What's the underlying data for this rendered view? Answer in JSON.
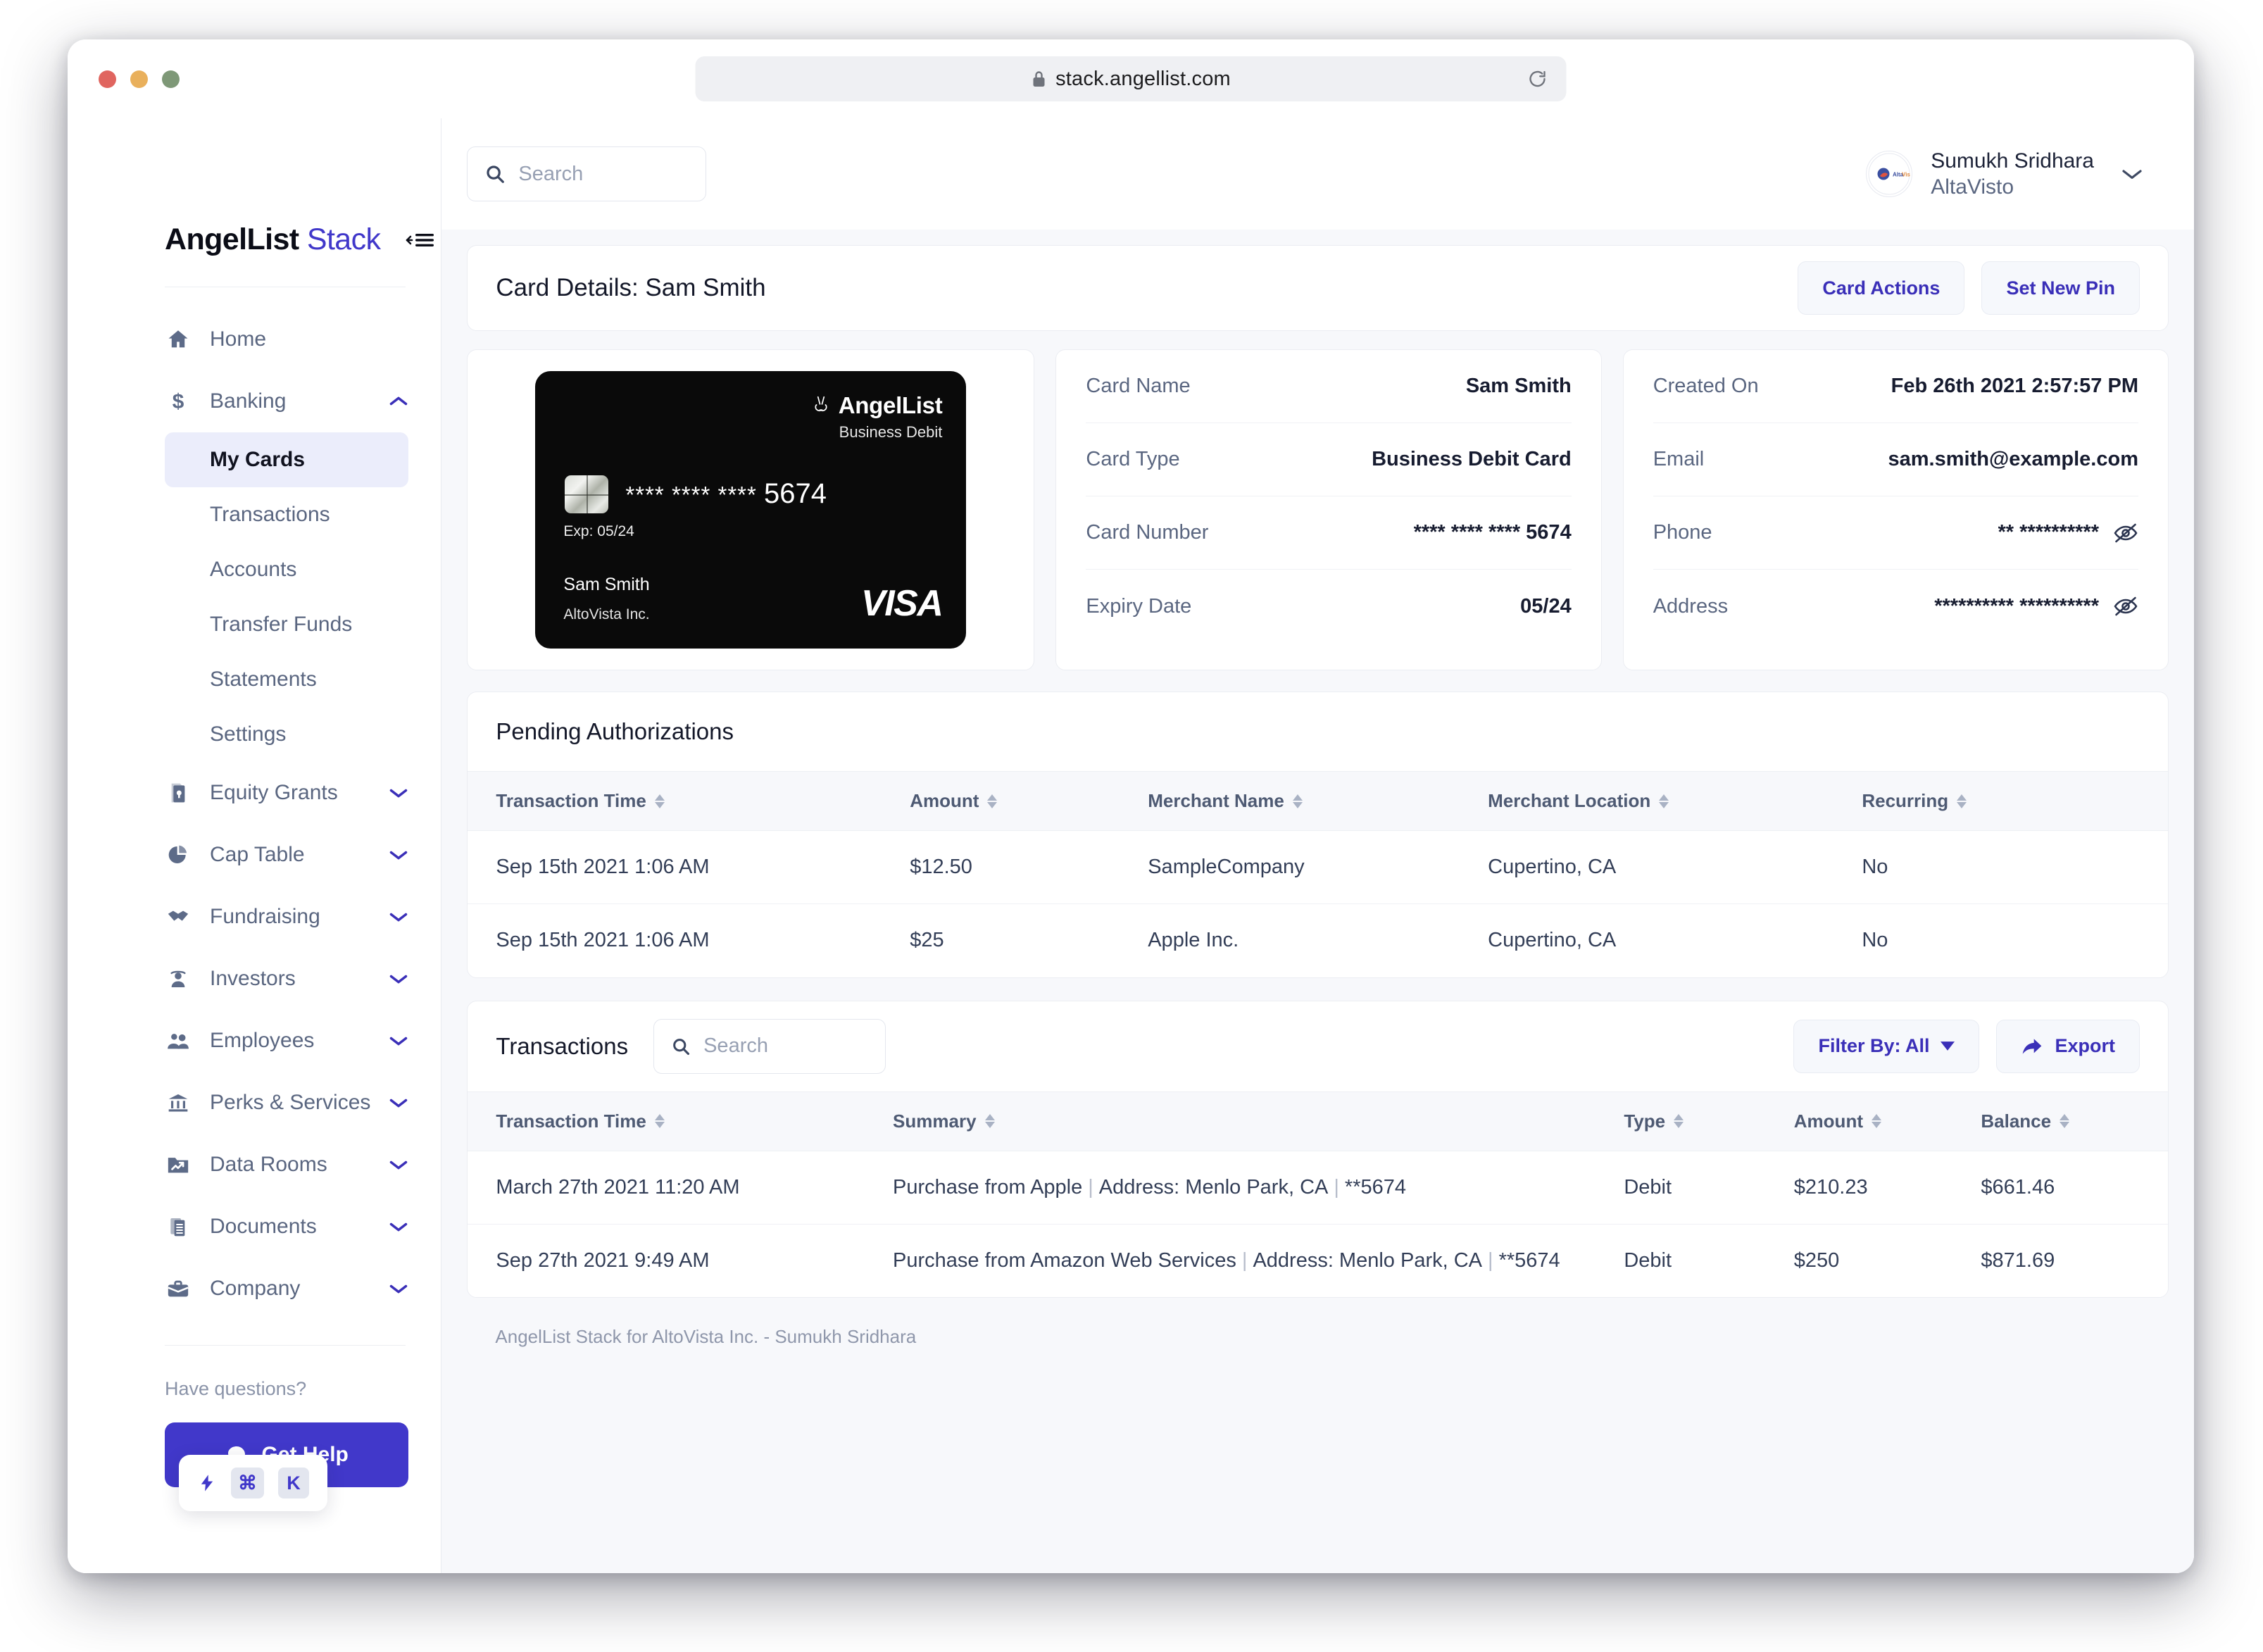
{
  "browser": {
    "url": "stack.angellist.com",
    "lock_icon": "lock-icon",
    "reload_icon": "reload-icon"
  },
  "sidebar": {
    "brand_primary": "AngelList",
    "brand_secondary": "Stack",
    "collapse_icon": "collapse-menu-icon",
    "nav": [
      {
        "label": "Home",
        "icon": "home-icon",
        "expandable": false
      },
      {
        "label": "Banking",
        "icon": "dollar-icon",
        "expandable": true,
        "expanded": true
      },
      {
        "label": "Equity Grants",
        "icon": "certificate-icon",
        "expandable": true
      },
      {
        "label": "Cap Table",
        "icon": "pie-chart-icon",
        "expandable": true
      },
      {
        "label": "Fundraising",
        "icon": "handshake-icon",
        "expandable": true
      },
      {
        "label": "Investors",
        "icon": "investor-icon",
        "expandable": true
      },
      {
        "label": "Employees",
        "icon": "people-icon",
        "expandable": true
      },
      {
        "label": "Perks & Services",
        "icon": "bank-icon",
        "expandable": true
      },
      {
        "label": "Data Rooms",
        "icon": "folder-chart-icon",
        "expandable": true
      },
      {
        "label": "Documents",
        "icon": "documents-icon",
        "expandable": true
      },
      {
        "label": "Company",
        "icon": "briefcase-icon",
        "expandable": true
      }
    ],
    "banking_subitems": [
      {
        "label": "My Cards",
        "active": true
      },
      {
        "label": "Transactions",
        "active": false
      },
      {
        "label": "Accounts",
        "active": false
      },
      {
        "label": "Transfer Funds",
        "active": false
      },
      {
        "label": "Statements",
        "active": false
      },
      {
        "label": "Settings",
        "active": false
      }
    ],
    "help_prompt": "Have questions?",
    "help_button": "Get Help",
    "help_icon": "chat-bubble-icon",
    "shortcut": {
      "bolt_icon": "lightning-bolt-icon",
      "key1": "⌘",
      "key2": "K"
    },
    "accent_color": "#4138ca",
    "active_bg": "#ebedfb"
  },
  "topbar": {
    "search_placeholder": "Search",
    "search_icon": "search-icon",
    "profile_name": "Sumukh Sridhara",
    "profile_org": "AltaVisto",
    "avatar_label": "AltaVisto",
    "chevron_icon": "chevron-down-icon"
  },
  "page": {
    "title": "Card Details: Sam Smith",
    "actions": [
      {
        "label": "Card Actions"
      },
      {
        "label": "Set New Pin"
      }
    ]
  },
  "credit_card": {
    "brand": "AngelList",
    "brand_icon": "angellist-peace-icon",
    "product": "Business Debit",
    "number_masked": "**** **** ****",
    "number_last4": "5674",
    "exp_label": "Exp: 05/24",
    "holder": "Sam Smith",
    "org": "AltoVista Inc.",
    "network": "VISA",
    "bg_color": "#0a0a0a"
  },
  "card_details_left": [
    {
      "label": "Card Name",
      "value": "Sam Smith",
      "masked": false
    },
    {
      "label": "Card Type",
      "value": "Business Debit Card",
      "masked": false
    },
    {
      "label": "Card Number",
      "value": "**** **** **** 5674",
      "masked": false
    },
    {
      "label": "Expiry Date",
      "value": "05/24",
      "masked": false
    }
  ],
  "card_details_right": [
    {
      "label": "Created On",
      "value": "Feb 26th 2021 2:57:57 PM",
      "masked": false
    },
    {
      "label": "Email",
      "value": "sam.smith@example.com",
      "masked": false
    },
    {
      "label": "Phone",
      "value": "** **********",
      "masked": true
    },
    {
      "label": "Address",
      "value": "********** **********",
      "masked": true
    }
  ],
  "pending": {
    "title": "Pending Authorizations",
    "columns": [
      "Transaction Time",
      "Amount",
      "Merchant Name",
      "Merchant Location",
      "Recurring"
    ],
    "rows": [
      {
        "time": "Sep 15th 2021 1:06 AM",
        "amount": "$12.50",
        "merchant": "SampleCompany",
        "location": "Cupertino, CA",
        "recurring": "No"
      },
      {
        "time": "Sep 15th 2021 1:06 AM",
        "amount": "$25",
        "merchant": "Apple Inc.",
        "location": "Cupertino, CA",
        "recurring": "No"
      }
    ]
  },
  "transactions": {
    "title": "Transactions",
    "search_placeholder": "Search",
    "filter_label": "Filter By: All",
    "export_label": "Export",
    "export_icon": "share-arrow-icon",
    "columns": [
      "Transaction Time",
      "Summary",
      "Type",
      "Amount",
      "Balance"
    ],
    "rows": [
      {
        "time": "March 27th 2021 11:20 AM",
        "summary_merchant": "Purchase from Apple",
        "summary_address": "Address: Menlo Park, CA",
        "summary_card": "**5674",
        "type": "Debit",
        "amount": "$210.23",
        "balance": "$661.46"
      },
      {
        "time": "Sep 27th 2021 9:49 AM",
        "summary_merchant": "Purchase from Amazon Web Services",
        "summary_address": "Address: Menlo Park, CA",
        "summary_card": "**5674",
        "type": "Debit",
        "amount": "$250",
        "balance": "$871.69"
      }
    ],
    "debit_color": "#e2504a"
  },
  "footer": {
    "text": "AngelList Stack for AltoVista Inc. - Sumukh Sridhara"
  }
}
